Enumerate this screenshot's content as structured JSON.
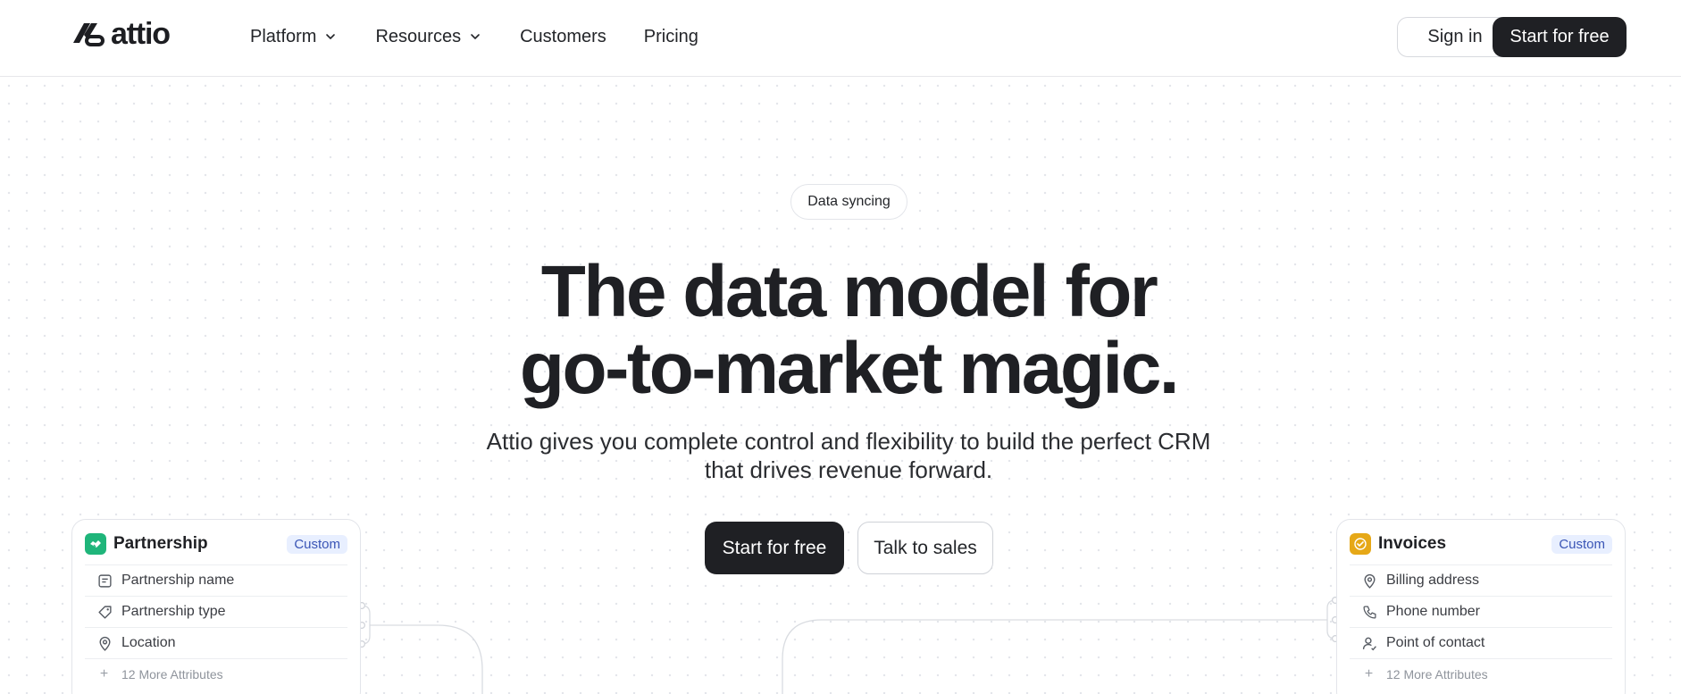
{
  "brand": {
    "name": "attio"
  },
  "nav": {
    "items": [
      {
        "label": "Platform",
        "has_dropdown": true
      },
      {
        "label": "Resources",
        "has_dropdown": true
      },
      {
        "label": "Customers",
        "has_dropdown": false
      },
      {
        "label": "Pricing",
        "has_dropdown": false
      }
    ],
    "signin_label": "Sign in",
    "start_label": "Start for free"
  },
  "hero": {
    "badge": "Data syncing",
    "headline_line1": "The data model for",
    "headline_line2": "go-to-market magic.",
    "subhead_line1": "Attio gives you complete control and flexibility to build the perfect CRM",
    "subhead_line2": "that drives revenue forward.",
    "primary_cta": "Start for free",
    "secondary_cta": "Talk to sales"
  },
  "cards": {
    "left": {
      "title": "Partnership",
      "badge": "Custom",
      "icon": "handshake-icon",
      "icon_color": "#1fb57a",
      "attributes": [
        {
          "label": "Partnership name",
          "icon": "text-field-icon"
        },
        {
          "label": "Partnership type",
          "icon": "tag-icon"
        },
        {
          "label": "Location",
          "icon": "map-pin-icon"
        }
      ],
      "more": "12 More Attributes"
    },
    "right": {
      "title": "Invoices",
      "badge": "Custom",
      "icon": "check-badge-icon",
      "icon_color": "#e6a817",
      "attributes": [
        {
          "label": "Billing address",
          "icon": "map-pin-icon"
        },
        {
          "label": "Phone number",
          "icon": "phone-icon"
        },
        {
          "label": "Point of contact",
          "icon": "user-contact-icon"
        }
      ],
      "more": "12 More Attributes"
    }
  },
  "colors": {
    "primary_button": "#1f2024",
    "badge_bg": "#e8efff",
    "badge_text": "#3a55b5"
  }
}
